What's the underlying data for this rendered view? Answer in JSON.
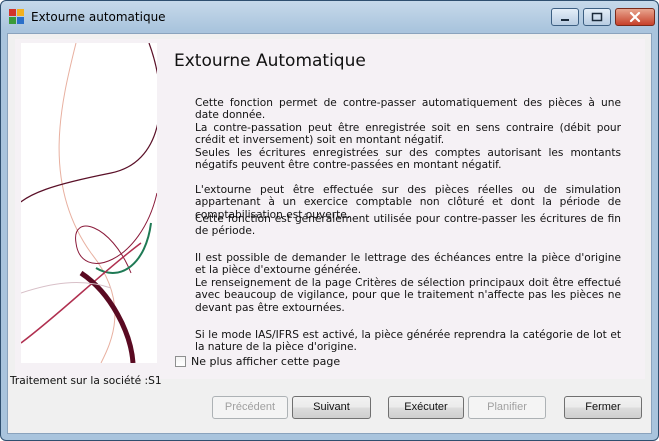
{
  "window": {
    "title": "Extourne automatique"
  },
  "page": {
    "title": "Extourne Automatique",
    "paragraphs": [
      "Cette fonction permet de contre-passer automatiquement des pièces à une date donnée.",
      "La contre-passation peut être enregistrée soit en sens contraire (débit pour crédit et inversement) soit en montant négatif.",
      "Seules les écritures enregistrées sur des comptes autorisant les montants négatifs peuvent être contre-passées en montant négatif.",
      "L'extourne peut être effectuée sur des pièces réelles ou de simulation appartenant à un exercice comptable non clôturé et dont la période de comptabilisation est ouverte.",
      "Cette fonction est généralement utilisée pour contre-passer les écritures de fin de période.",
      "Il est possible de demander le lettrage des échéances entre la pièce d'origine et la pièce d'extourne générée.",
      "Le renseignement de la page Critères de sélection principaux doit être effectué avec beaucoup de vigilance, pour que le traitement n'affecte pas les pièces ne devant pas être extournées.",
      "Si le mode IAS/IFRS est activé, la pièce générée reprendra la catégorie de lot et la nature de la pièce d'origine."
    ],
    "checkbox_label": "Ne plus afficher cette page",
    "checkbox_checked": false
  },
  "status": {
    "text": "Traitement sur la société :S1"
  },
  "buttons": {
    "previous": "Précédent",
    "next": "Suivant",
    "execute": "Exécuter",
    "schedule": "Planifier",
    "close": "Fermer"
  },
  "colors": {
    "accent_dark_red": "#6b0f2a",
    "accent_green": "#1f7a55",
    "title_bar": "#a9c4dd",
    "close_button": "#c7412a"
  }
}
